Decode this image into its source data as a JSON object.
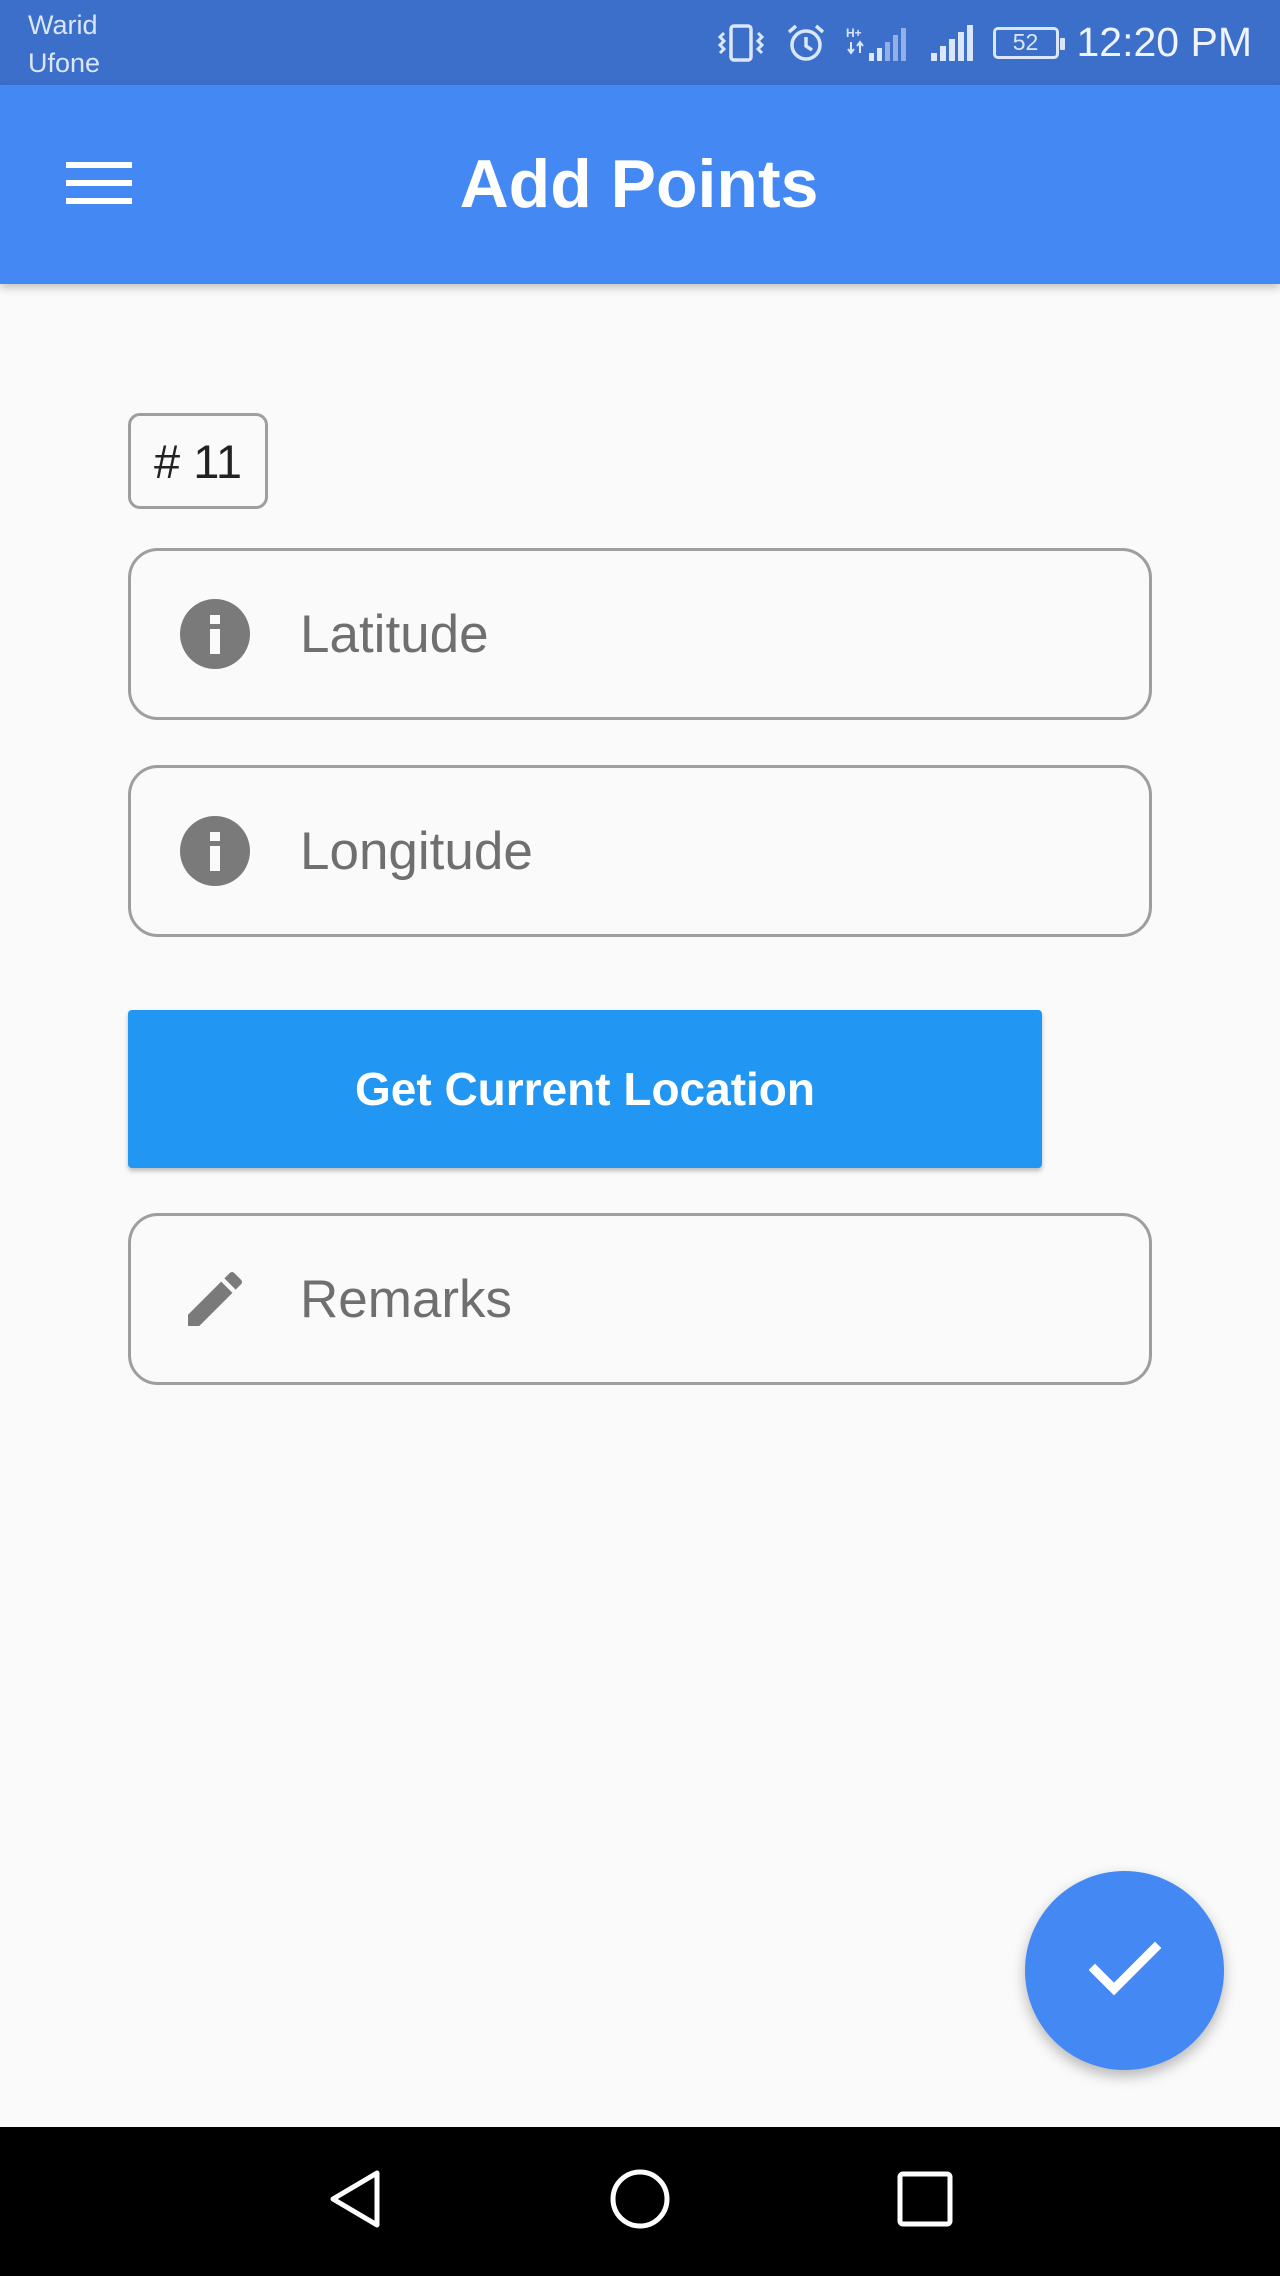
{
  "status_bar": {
    "carriers": [
      "Warid",
      "Ufone"
    ],
    "battery_level": "52",
    "time": "12:20 PM",
    "icons": [
      "vibrate-icon",
      "alarm-icon",
      "signal-h-plus-icon",
      "signal-icon",
      "battery-icon"
    ]
  },
  "app_bar": {
    "title": "Add Points",
    "menu_icon": "hamburger-menu-icon"
  },
  "form": {
    "point_number": "# 11",
    "latitude": {
      "value": "",
      "placeholder": "Latitude",
      "icon": "info-icon"
    },
    "longitude": {
      "value": "",
      "placeholder": "Longitude",
      "icon": "info-icon"
    },
    "get_location_label": "Get Current Location",
    "remarks": {
      "value": "",
      "placeholder": "Remarks",
      "icon": "pencil-icon"
    }
  },
  "fab": {
    "icon": "check-icon"
  },
  "nav_bar": {
    "icons": [
      "back-icon",
      "home-icon",
      "recents-icon"
    ]
  },
  "colors": {
    "status_bar": "#3b6fc9",
    "app_bar": "#4388f3",
    "button": "#2196f3",
    "background": "#fafafa",
    "field_border": "#9e9e9e",
    "icon_gray": "#7a7a7a"
  }
}
